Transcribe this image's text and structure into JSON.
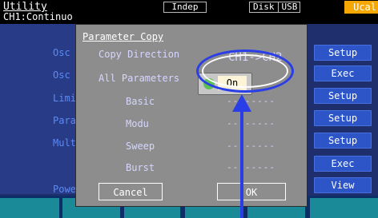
{
  "topbar": {
    "title": "Utility",
    "subtitle": "CH1:Continuo",
    "mode": "Indep",
    "disk": "Disk",
    "usb": "USB",
    "ucal": "Ucal"
  },
  "menu": {
    "items": [
      "Osc",
      "Osc",
      "Limi",
      "Para",
      "Mult",
      "Powe"
    ]
  },
  "right_buttons": [
    "Setup",
    "Exec",
    "Setup",
    "Setup",
    "Setup",
    "Exec",
    "View"
  ],
  "dialog": {
    "title": "Parameter Copy",
    "copy_direction_label": "Copy Direction",
    "copy_direction_value": "CH1->CH2",
    "all_parameters_label": "All Parameters",
    "all_parameters_value": "On",
    "basic_label": "Basic",
    "modu_label": "Modu",
    "sweep_label": "Sweep",
    "burst_label": "Burst",
    "dashes": "--------",
    "cancel_label": "Cancel",
    "ok_label": "OK"
  },
  "colors": {
    "background": "#1f2f6e",
    "button_blue": "#2d55c7",
    "ucal_orange": "#f6a800",
    "callout_blue": "#2a3ee8",
    "led_green": "#5fbf56"
  }
}
